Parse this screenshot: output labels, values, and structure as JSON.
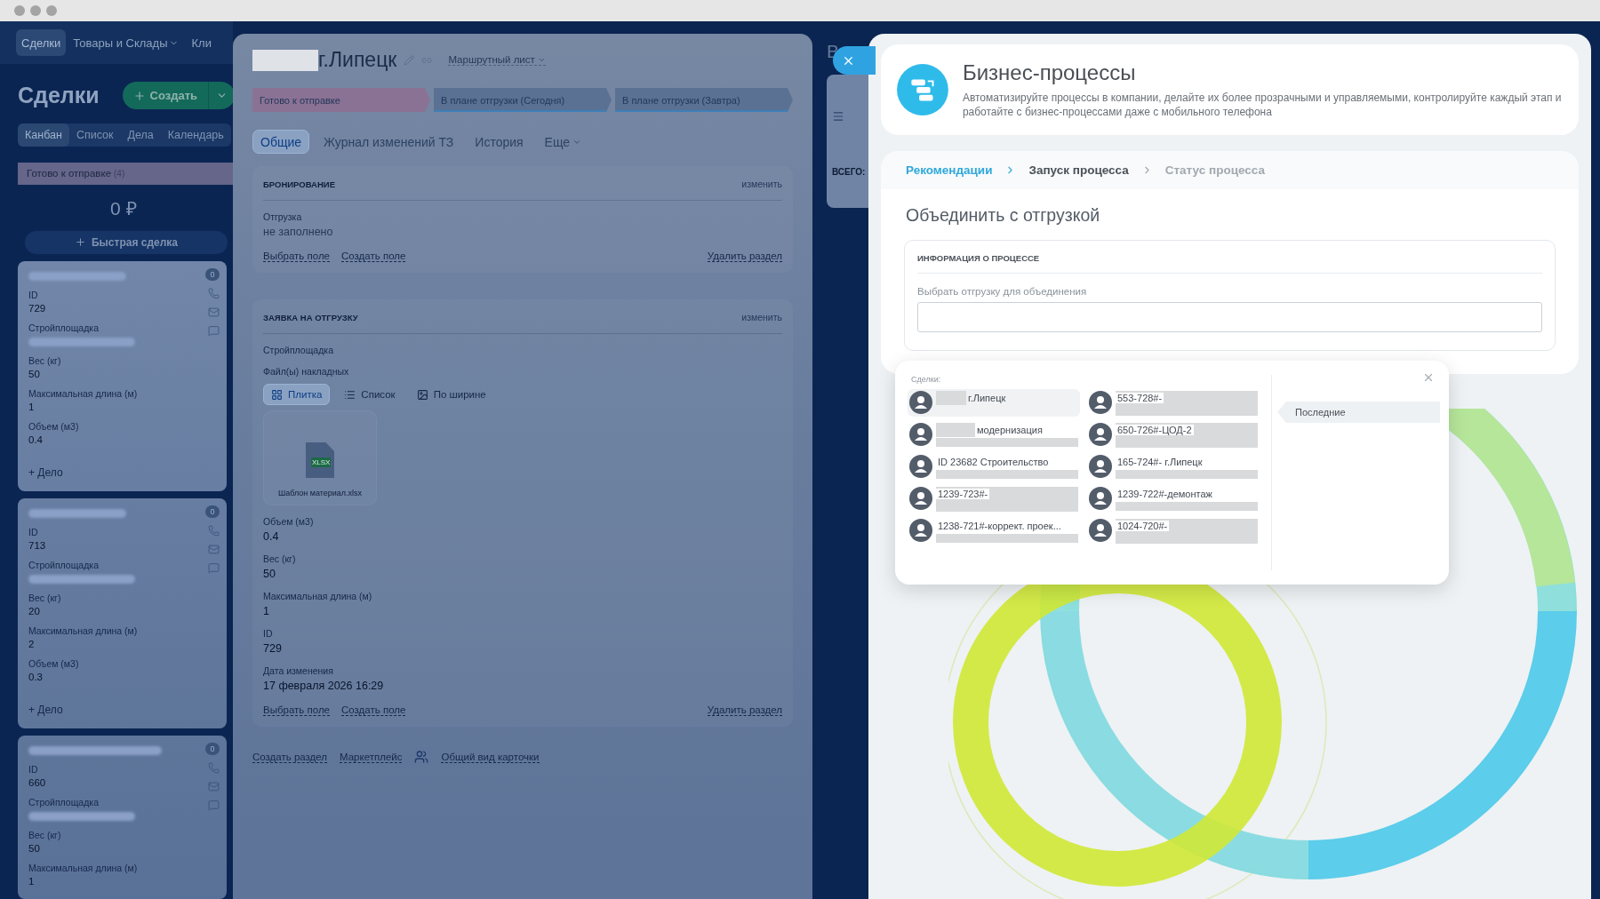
{
  "top_nav": [
    {
      "label": "Сделки",
      "selected": true,
      "dropdown": false
    },
    {
      "label": "Товары и Склады",
      "selected": false,
      "dropdown": true
    },
    {
      "label": "Кли",
      "selected": false,
      "dropdown": false
    }
  ],
  "crm": {
    "title": "Сделки",
    "create_button": "Создать",
    "views": [
      {
        "label": "Канбан",
        "selected": true
      },
      {
        "label": "Список",
        "selected": false
      },
      {
        "label": "Дела",
        "selected": false
      },
      {
        "label": "Календарь",
        "selected": false
      }
    ],
    "column": {
      "title": "Готово к отправке",
      "count": "(4)",
      "total": "0 ₽",
      "quick_deal": "Быстрая сделка",
      "cards": [
        {
          "badge": "0",
          "add_task": "+ Дело",
          "fields": [
            {
              "label": "ID",
              "value": "729"
            },
            {
              "label": "Стройплощадка",
              "blurred": true
            },
            {
              "label": "Вес (кг)",
              "value": "50"
            },
            {
              "label": "Максимальная длина (м)",
              "value": "1"
            },
            {
              "label": "Объем (м3)",
              "value": "0.4"
            }
          ]
        },
        {
          "badge": "0",
          "add_task": "+ Дело",
          "fields": [
            {
              "label": "ID",
              "value": "713"
            },
            {
              "label": "Стройплощадка",
              "blurred": true
            },
            {
              "label": "Вес (кг)",
              "value": "20"
            },
            {
              "label": "Максимальная длина (м)",
              "value": "2"
            },
            {
              "label": "Объем (м3)",
              "value": "0.3"
            }
          ]
        },
        {
          "badge": "0",
          "fields": [
            {
              "label": "ID",
              "value": "660"
            },
            {
              "label": "Стройплощадка",
              "blurred": true
            },
            {
              "label": "Вес (кг)",
              "value": "50"
            },
            {
              "label": "Максимальная длина (м)",
              "value": "1"
            }
          ]
        }
      ]
    }
  },
  "deal": {
    "title": "г.Липецк",
    "doc_menu": "Маршрутный лист",
    "stages": [
      {
        "label": "Готово к отправке",
        "selected": true
      },
      {
        "label": "В плане отгрузки (Сегодня)",
        "selected": false
      },
      {
        "label": "В плане отгрузки (Завтра)",
        "selected": false
      }
    ],
    "tabs": [
      {
        "label": "Общие",
        "selected": true,
        "dropdown": false
      },
      {
        "label": "Журнал изменений ТЗ",
        "selected": false,
        "dropdown": false
      },
      {
        "label": "История",
        "selected": false,
        "dropdown": false
      },
      {
        "label": "Еще",
        "selected": false,
        "dropdown": true
      }
    ],
    "sections": [
      {
        "title": "БРОНИРОВАНИЕ",
        "edit": "изменить",
        "links": [
          "Выбрать поле",
          "Создать поле"
        ],
        "delete": "Удалить раздел",
        "fields": [
          {
            "kind": "text",
            "label": "Отгрузка",
            "value": "не заполнено",
            "empty": true
          }
        ]
      },
      {
        "title": "ЗАЯВКА НА ОТГРУЗКУ",
        "edit": "изменить",
        "links": [
          "Выбрать поле",
          "Создать поле"
        ],
        "delete": "Удалить раздел",
        "fields": [
          {
            "kind": "text",
            "label": "Стройплощадка"
          },
          {
            "kind": "files",
            "label": "Файл(ы) накладных",
            "views": [
              {
                "label": "Плитка",
                "selected": true
              },
              {
                "label": "Список",
                "selected": false
              },
              {
                "label": "По ширине",
                "selected": false
              }
            ],
            "file": {
              "name": "Шаблон материал.xlsx",
              "ext": "XLSX"
            }
          },
          {
            "kind": "text",
            "label": "Объем (м3)",
            "value": "0.4"
          },
          {
            "kind": "text",
            "label": "Вес (кг)",
            "value": "50"
          },
          {
            "kind": "text",
            "label": "Максимальная длина (м)",
            "value": "1"
          },
          {
            "kind": "text",
            "label": "ID",
            "value": "729"
          },
          {
            "kind": "text",
            "label": "Дата изменения",
            "value": "17 февраля 2026 16:29"
          }
        ]
      }
    ],
    "footer_links": [
      "Создать раздел",
      "Маркетплейс",
      "Общий вид карточки"
    ]
  },
  "behind_panel": {
    "title": "В",
    "total_label": "ВСЕГО:"
  },
  "bp": {
    "title": "Бизнес-процессы",
    "description": "Автоматизируйте процессы в компании, делайте их более прозрачными и управляемыми, контролируйте каждый этап и работайте с бизнес-процессами даже с мобильного телефона",
    "breadcrumbs": [
      {
        "label": "Рекомендации",
        "kind": "done"
      },
      {
        "label": "Запуск процесса",
        "kind": "current"
      },
      {
        "label": "Статус процесса",
        "kind": "next"
      }
    ],
    "heading": "Объединить с отгрузкой",
    "info_title": "ИНФОРМАЦИЯ О ПРОЦЕССЕ",
    "field_label": "Выбрать отгрузку для объединения"
  },
  "popup": {
    "title": "Сделки:",
    "tabs": [
      {
        "label": "Последние",
        "selected": true
      }
    ],
    "items": [
      {
        "label": "г.Липецк",
        "kind": "lead",
        "selected": true
      },
      {
        "label": "553-728#-",
        "kind": "block",
        "selected": false
      },
      {
        "label": "модернизация",
        "kind": "lead_line",
        "selected": false
      },
      {
        "label": "650-726#-ЦОД-2",
        "kind": "block",
        "selected": false
      },
      {
        "label": "ID 23682 Строительство",
        "kind": "line",
        "selected": false
      },
      {
        "label": "165-724#- г.Липецк",
        "kind": "line",
        "selected": false
      },
      {
        "label": "1239-723#-",
        "kind": "block",
        "selected": false
      },
      {
        "label": "1239-722#-демонтаж",
        "kind": "line",
        "selected": false
      },
      {
        "label": "1238-721#-коррект. проек...",
        "kind": "line",
        "selected": false
      },
      {
        "label": "1024-720#-",
        "kind": "block",
        "selected": false
      }
    ]
  }
}
